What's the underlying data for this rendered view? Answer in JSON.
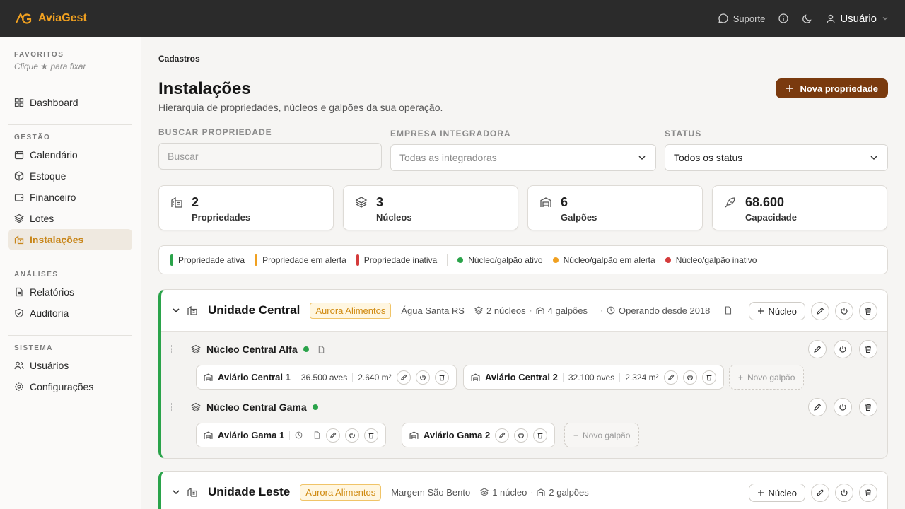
{
  "app": {
    "name": "AviaGest",
    "brand_color": "#f0a020"
  },
  "topbar": {
    "support": "Suporte",
    "user": "Usuário"
  },
  "sidebar": {
    "favorites_title": "FAVORITOS",
    "favorites_hint": "Clique ★ para fixar",
    "dashboard": "Dashboard",
    "gestao_title": "GESTÃO",
    "gestao": [
      "Calendário",
      "Estoque",
      "Financeiro",
      "Lotes",
      "Instalações"
    ],
    "analises_title": "ANÁLISES",
    "analises": [
      "Relatórios",
      "Auditoria"
    ],
    "sistema_title": "SISTEMA",
    "sistema": [
      "Usuários",
      "Configurações"
    ]
  },
  "page": {
    "breadcrumb": "Cadastros",
    "title": "Instalações",
    "subtitle": "Hierarquia de propriedades, núcleos e galpões da sua operação.",
    "new_button": "Nova propriedade"
  },
  "filters": {
    "search_label": "BUSCAR PROPRIEDADE",
    "search_placeholder": "Buscar",
    "company_label": "EMPRESA INTEGRADORA",
    "company_value": "Todas as integradoras",
    "status_label": "STATUS",
    "status_value": "Todos os status"
  },
  "stats": [
    {
      "value": "2",
      "label": "Propriedades"
    },
    {
      "value": "3",
      "label": "Núcleos"
    },
    {
      "value": "6",
      "label": "Galpões"
    },
    {
      "value": "68.600",
      "label": "Capacidade"
    }
  ],
  "legend": {
    "prop_active": "Propriedade ativa",
    "prop_alert": "Propriedade em alerta",
    "prop_inactive": "Propriedade inativa",
    "nuc_active": "Núcleo/galpão ativo",
    "nuc_alert": "Núcleo/galpão em alerta",
    "nuc_inactive": "Núcleo/galpão inativo",
    "colors": {
      "active": "#2aa34a",
      "alert": "#f0a020",
      "inactive": "#d43b3b"
    }
  },
  "properties": [
    {
      "name": "Unidade Central",
      "company": "Aurora Alimentos",
      "location": "Água Santa RS",
      "nucleos": "2 núcleos",
      "galpoes": "4 galpões",
      "since": "Operando desde 2018",
      "add_nucleo": "Núcleo",
      "nucleos_list": [
        {
          "name": "Núcleo Central Alfa",
          "galpoes": [
            {
              "name": "Aviário Central 1",
              "aves": "36.500 aves",
              "area": "2.640 m²"
            },
            {
              "name": "Aviário Central 2",
              "aves": "32.100 aves",
              "area": "2.324 m²"
            }
          ],
          "new_galpao": "Novo galpão"
        },
        {
          "name": "Núcleo Central Gama",
          "galpoes": [
            {
              "name": "Aviário Gama 1"
            },
            {
              "name": "Aviário Gama 2"
            }
          ],
          "new_galpao": "Novo galpão"
        }
      ]
    },
    {
      "name": "Unidade Leste",
      "company": "Aurora Alimentos",
      "location": "Margem São Bento",
      "nucleos": "1 núcleo",
      "galpoes": "2 galpões",
      "add_nucleo": "Núcleo"
    }
  ]
}
